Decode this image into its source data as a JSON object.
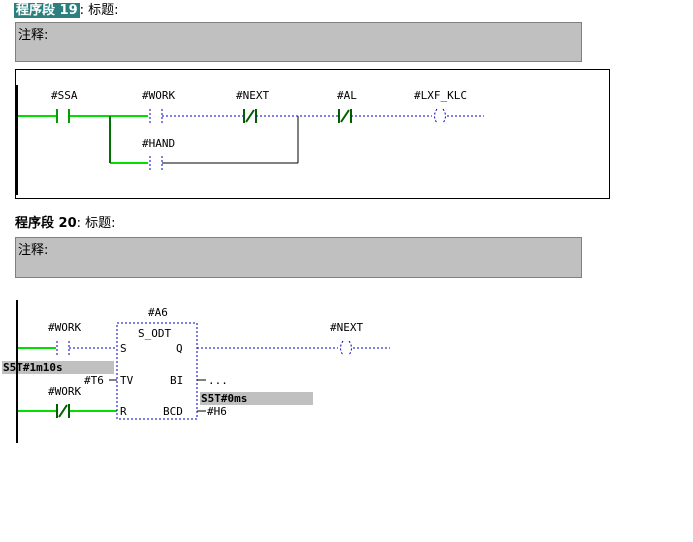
{
  "networks": [
    {
      "prefix": "程序段",
      "number": "19",
      "title_sep": ": 标题:",
      "comment_label": "注释:",
      "operands": {
        "ssa": "#SSA",
        "work": "#WORK",
        "next": "#NEXT",
        "al": "#AL",
        "coil": "#LXF_KLC",
        "hand": "#HAND"
      }
    },
    {
      "prefix": "程序段",
      "number": "20",
      "title_sep": ": 标题:",
      "comment_label": "注释:",
      "timer": {
        "name": "#A6",
        "type": "S_ODT",
        "pin_s": "S",
        "pin_q": "Q",
        "pin_tv": "TV",
        "pin_bi": "BI",
        "pin_r": "R",
        "pin_bcd": "BCD"
      },
      "operands": {
        "work_s": "#WORK",
        "tv_value": "S5T#1m10s",
        "tv_label": "#T6",
        "work_r": "#WORK",
        "bi_out": "...",
        "bcd_value": "S5T#0ms",
        "bcd_out": "#H6",
        "coil": "#NEXT"
      }
    }
  ],
  "colors": {
    "power_flow": "#00e000",
    "no_flow": "#0000c0",
    "header_highlight": "#2c7f7f",
    "comment_bg": "#c0c0c0"
  }
}
